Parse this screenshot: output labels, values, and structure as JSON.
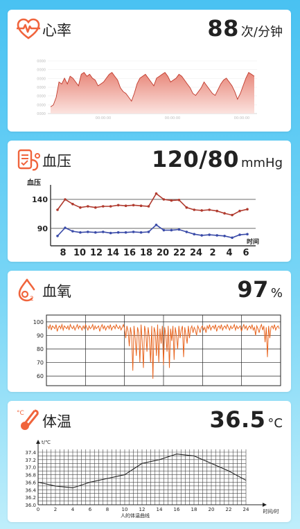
{
  "cards": {
    "heart": {
      "title": "心率",
      "value": "88",
      "unit": "次/分钟",
      "icon": "heart-pulse-icon",
      "chart_data": {
        "type": "area",
        "series": [
          {
            "values": [
              102,
              104,
              112,
              128,
              126,
              132,
              126,
              134,
              132,
              128,
              124,
              136,
              138,
              134,
              136,
              132,
              130,
              124,
              126,
              128,
              132,
              136,
              138,
              134,
              130,
              122,
              118,
              116,
              112,
              108,
              116,
              126,
              132,
              134,
              136,
              132,
              128,
              124,
              132,
              134,
              136,
              138,
              134,
              128,
              130,
              132,
              136,
              134,
              130,
              126,
              122,
              116,
              114,
              118,
              122,
              128,
              124,
              120,
              116,
              114,
              120,
              126,
              130,
              132,
              128,
              124,
              118,
              110,
              116,
              124,
              132,
              138,
              136,
              134
            ]
          }
        ],
        "ylim": [
          95,
          150
        ],
        "y_ticks": [
          "0000",
          "0000",
          "0000",
          "0000",
          "0000",
          "0000",
          "0000"
        ],
        "x_ticks": [
          "00:00:00",
          "00:00:00",
          "00:00:00"
        ],
        "color": "#c0392b",
        "fill": "#f2c3bd"
      }
    },
    "bp": {
      "title": "血压",
      "value": "120/80",
      "unit": "mmHg",
      "icon": "blood-pressure-icon",
      "chart_data": {
        "type": "line",
        "ylabel": "血压",
        "xlabel": "时间",
        "x_ticks": [
          "8",
          "10",
          "12",
          "14",
          "16",
          "18",
          "20",
          "22",
          "24",
          "2",
          "4",
          "6"
        ],
        "ref_lines": [
          140,
          90
        ],
        "ref_labels": [
          "140",
          "90"
        ],
        "ylim": [
          60,
          165
        ],
        "series": [
          {
            "values": [
              122,
              140,
              132,
              126,
              128,
              126,
              128,
              128,
              130,
              129,
              130,
              129,
              128,
              150,
              140,
              138,
              139,
              126,
              122,
              121,
              122,
              120,
              116,
              113,
              120,
              123
            ],
            "color": "#b03a2e"
          },
          {
            "values": [
              77,
              91,
              85,
              83,
              84,
              83,
              84,
              82,
              83,
              83,
              84,
              83,
              84,
              96,
              87,
              87,
              88,
              84,
              80,
              78,
              79,
              78,
              77,
              74,
              79,
              80
            ],
            "color": "#3a4ba8"
          }
        ]
      }
    },
    "spo2": {
      "title": "血氧",
      "value": "97",
      "unit": "%",
      "icon": "oxygen-drop-icon",
      "chart_data": {
        "type": "line",
        "y_ticks": [
          "100",
          "90",
          "80",
          "70",
          "60"
        ],
        "ylim": [
          57,
          103
        ],
        "color": "#e8641e",
        "series": [
          {
            "values": [
              97,
              95,
              98,
              94,
              97,
              96,
              95,
              98,
              93,
              96,
              97,
              95,
              98,
              94,
              97,
              96,
              95,
              97,
              94,
              98,
              96,
              95,
              97,
              94,
              96,
              98,
              95,
              97,
              96,
              94,
              97,
              95,
              98,
              96,
              94,
              97,
              95,
              96,
              98,
              94,
              97,
              95,
              96,
              97,
              93,
              96,
              98,
              95,
              97,
              94,
              96,
              97,
              95,
              98,
              94,
              96,
              97,
              95,
              98,
              96,
              95,
              97,
              94,
              96,
              98,
              95,
              88,
              97,
              93,
              82,
              96,
              90,
              64,
              97,
              88,
              75,
              96,
              92,
              70,
              98,
              85,
              66,
              97,
              92,
              78,
              96,
              88,
              70,
              97,
              58,
              96,
              92,
              75,
              98,
              70,
              95,
              84,
              97,
              68,
              96,
              90,
              78,
              97,
              66,
              95,
              86,
              97,
              72,
              96,
              90,
              80,
              97,
              88,
              94,
              97,
              74,
              96,
              90,
              84,
              97,
              88,
              95,
              97,
              92,
              96,
              94,
              90,
              97,
              95,
              92,
              96,
              97,
              94,
              96,
              92,
              97,
              95,
              98,
              94,
              96,
              97,
              95,
              98,
              93,
              96,
              97,
              95,
              98,
              94,
              96,
              97,
              95,
              98,
              96,
              94,
              97,
              95,
              96,
              98,
              94,
              97,
              95,
              96,
              97,
              93,
              96,
              98,
              95,
              97,
              94,
              96,
              97,
              95,
              98,
              94,
              96,
              90,
              97,
              95,
              92,
              96,
              98,
              94,
              97,
              85,
              96,
              74,
              97,
              88,
              96,
              97,
              95,
              98,
              94,
              96,
              97,
              95
            ]
          }
        ]
      }
    },
    "temp": {
      "title": "体温",
      "value": "36.5",
      "unit": "°C",
      "icon": "thermometer-icon",
      "chart_data": {
        "type": "line",
        "title": "人的体温曲线",
        "ylabel": "t/℃",
        "xlabel": "时间/时",
        "x": [
          0,
          2,
          4,
          6,
          8,
          10,
          12,
          14,
          16,
          18,
          20,
          22,
          24
        ],
        "x_ticks": [
          "0",
          "2",
          "4",
          "6",
          "8",
          "10",
          "12",
          "14",
          "16",
          "18",
          "20",
          "22",
          "24"
        ],
        "y_ticks": [
          "36.0",
          "36.2",
          "36.4",
          "36.6",
          "36.8",
          "37.0",
          "37.2",
          "37.4"
        ],
        "ylim": [
          36.0,
          37.4
        ],
        "series": [
          {
            "values": [
              36.6,
              36.5,
              36.45,
              36.6,
              36.7,
              36.8,
              37.1,
              37.2,
              37.35,
              37.3,
              37.1,
              36.9,
              36.65
            ]
          }
        ]
      }
    }
  }
}
